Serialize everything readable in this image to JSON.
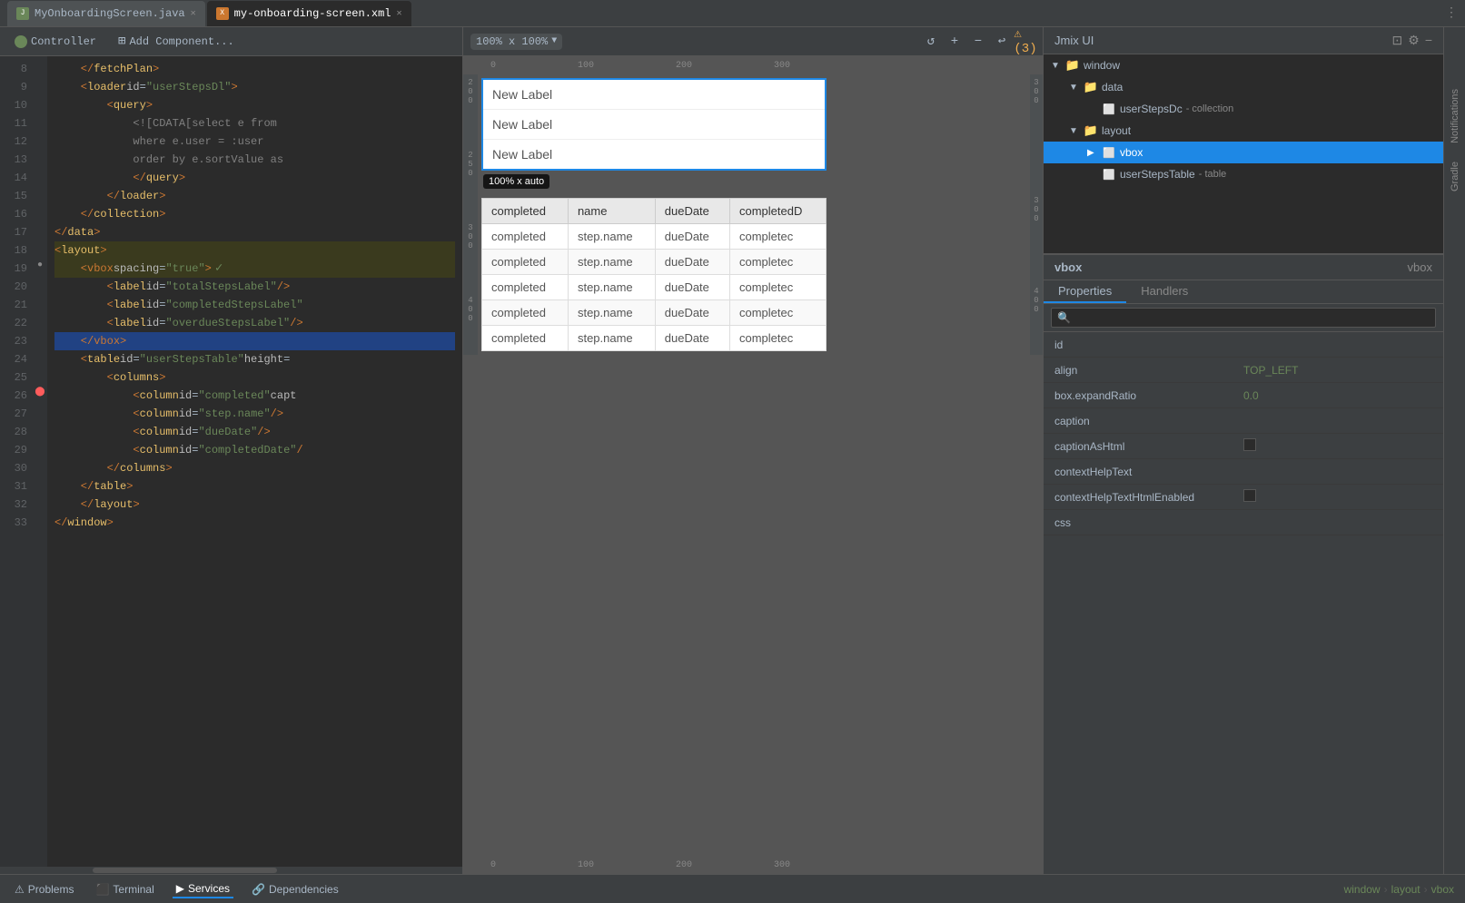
{
  "titleBar": {
    "tabs": [
      {
        "id": "java",
        "label": "MyOnboardingScreen.java",
        "active": false,
        "iconType": "java"
      },
      {
        "id": "xml",
        "label": "my-onboarding-screen.xml",
        "active": true,
        "iconType": "xml"
      }
    ]
  },
  "editorToolbar": {
    "controllerLabel": "Controller",
    "addComponentLabel": "Add Component..."
  },
  "codeLines": [
    {
      "num": 8,
      "content": "    </fetchPlan>",
      "type": "normal"
    },
    {
      "num": 9,
      "content": "    <loader id=\"userStepsDl\">",
      "type": "normal"
    },
    {
      "num": 10,
      "content": "        <query>",
      "type": "normal"
    },
    {
      "num": 11,
      "content": "            <![CDATA[select e from",
      "type": "normal"
    },
    {
      "num": 12,
      "content": "            where e.user = :user",
      "type": "normal"
    },
    {
      "num": 13,
      "content": "            order by e.sortValue as",
      "type": "normal"
    },
    {
      "num": 14,
      "content": "            </query>",
      "type": "normal"
    },
    {
      "num": 15,
      "content": "        </loader>",
      "type": "normal"
    },
    {
      "num": 16,
      "content": "    </collection>",
      "type": "normal"
    },
    {
      "num": 17,
      "content": "</data>",
      "type": "normal"
    },
    {
      "num": 18,
      "content": "<layout>",
      "type": "normal"
    },
    {
      "num": 19,
      "content": "    <vbox spacing=\"true\">",
      "type": "highlighted"
    },
    {
      "num": 20,
      "content": "        <label id=\"totalStepsLabel\"/>",
      "type": "normal"
    },
    {
      "num": 21,
      "content": "        <label id=\"completedStepsLabel\"",
      "type": "normal"
    },
    {
      "num": 22,
      "content": "        <label id=\"overdueStepsLabel\"/>",
      "type": "normal"
    },
    {
      "num": 23,
      "content": "    </vbox>",
      "type": "selected"
    },
    {
      "num": 24,
      "content": "    <table id=\"userStepsTable\" height=",
      "type": "normal"
    },
    {
      "num": 25,
      "content": "        <columns>",
      "type": "normal"
    },
    {
      "num": 26,
      "content": "            <column id=\"completed\" capt",
      "type": "error",
      "hasError": true
    },
    {
      "num": 27,
      "content": "            <column id=\"step.name\"/>",
      "type": "normal"
    },
    {
      "num": 28,
      "content": "            <column id=\"dueDate\"/>",
      "type": "normal"
    },
    {
      "num": 29,
      "content": "            <column id=\"completedDate\"/",
      "type": "normal"
    },
    {
      "num": 30,
      "content": "        </columns>",
      "type": "normal"
    },
    {
      "num": 31,
      "content": "    </table>",
      "type": "normal"
    },
    {
      "num": 32,
      "content": "    </layout>",
      "type": "normal"
    },
    {
      "num": 33,
      "content": "</window>",
      "type": "normal"
    }
  ],
  "preview": {
    "zoom": "100% x 100%",
    "labels": [
      "New Label",
      "New Label",
      "New Label"
    ],
    "sizeBadge": "100% x auto",
    "tableHeaders": [
      "completed",
      "name",
      "dueDate",
      "completedD"
    ],
    "tableRows": [
      [
        "completed",
        "step.name",
        "dueDate",
        "completec"
      ],
      [
        "completed",
        "step.name",
        "dueDate",
        "completec"
      ],
      [
        "completed",
        "step.name",
        "dueDate",
        "completec"
      ],
      [
        "completed",
        "step.name",
        "dueDate",
        "completec"
      ],
      [
        "completed",
        "step.name",
        "dueDate",
        "completec"
      ]
    ],
    "rulerMarks": [
      "0",
      "100",
      "200",
      "300"
    ]
  },
  "jmixUI": {
    "title": "Jmix UI",
    "tree": [
      {
        "level": 0,
        "label": "window",
        "type": "folder",
        "expanded": true,
        "arrow": "▼"
      },
      {
        "level": 1,
        "label": "data",
        "type": "folder",
        "expanded": true,
        "arrow": "▼"
      },
      {
        "level": 2,
        "label": "userStepsDc",
        "type": "component",
        "sublabel": "- collection",
        "expanded": false,
        "arrow": ""
      },
      {
        "level": 1,
        "label": "layout",
        "type": "folder",
        "expanded": true,
        "arrow": "▼"
      },
      {
        "level": 2,
        "label": "vbox",
        "type": "component",
        "sublabel": "",
        "expanded": false,
        "arrow": ">",
        "selected": true
      },
      {
        "level": 3,
        "label": "userStepsTable",
        "type": "component",
        "sublabel": "- table",
        "expanded": false,
        "arrow": ""
      }
    ]
  },
  "properties": {
    "componentLabel": "vbox",
    "componentId": "vbox",
    "tabs": [
      "Properties",
      "Handlers"
    ],
    "activeTab": "Properties",
    "searchPlaceholder": "🔍",
    "rows": [
      {
        "name": "id",
        "value": "",
        "type": "text"
      },
      {
        "name": "align",
        "value": "TOP_LEFT",
        "type": "text"
      },
      {
        "name": "box.expandRatio",
        "value": "0.0",
        "type": "text"
      },
      {
        "name": "caption",
        "value": "",
        "type": "text"
      },
      {
        "name": "captionAsHtml",
        "value": "",
        "type": "checkbox"
      },
      {
        "name": "contextHelpText",
        "value": "",
        "type": "text"
      },
      {
        "name": "contextHelpTextHtmlEnabled",
        "value": "",
        "type": "checkbox"
      },
      {
        "name": "css",
        "value": "",
        "type": "text"
      }
    ]
  },
  "bottomBar": {
    "tabs": [
      "Problems",
      "Terminal",
      "Services",
      "Dependencies"
    ],
    "activeTab": "Services",
    "breadcrumb": [
      "window",
      "layout",
      "vbox"
    ]
  },
  "sideTabs": [
    "Notifications",
    "Gradle"
  ]
}
